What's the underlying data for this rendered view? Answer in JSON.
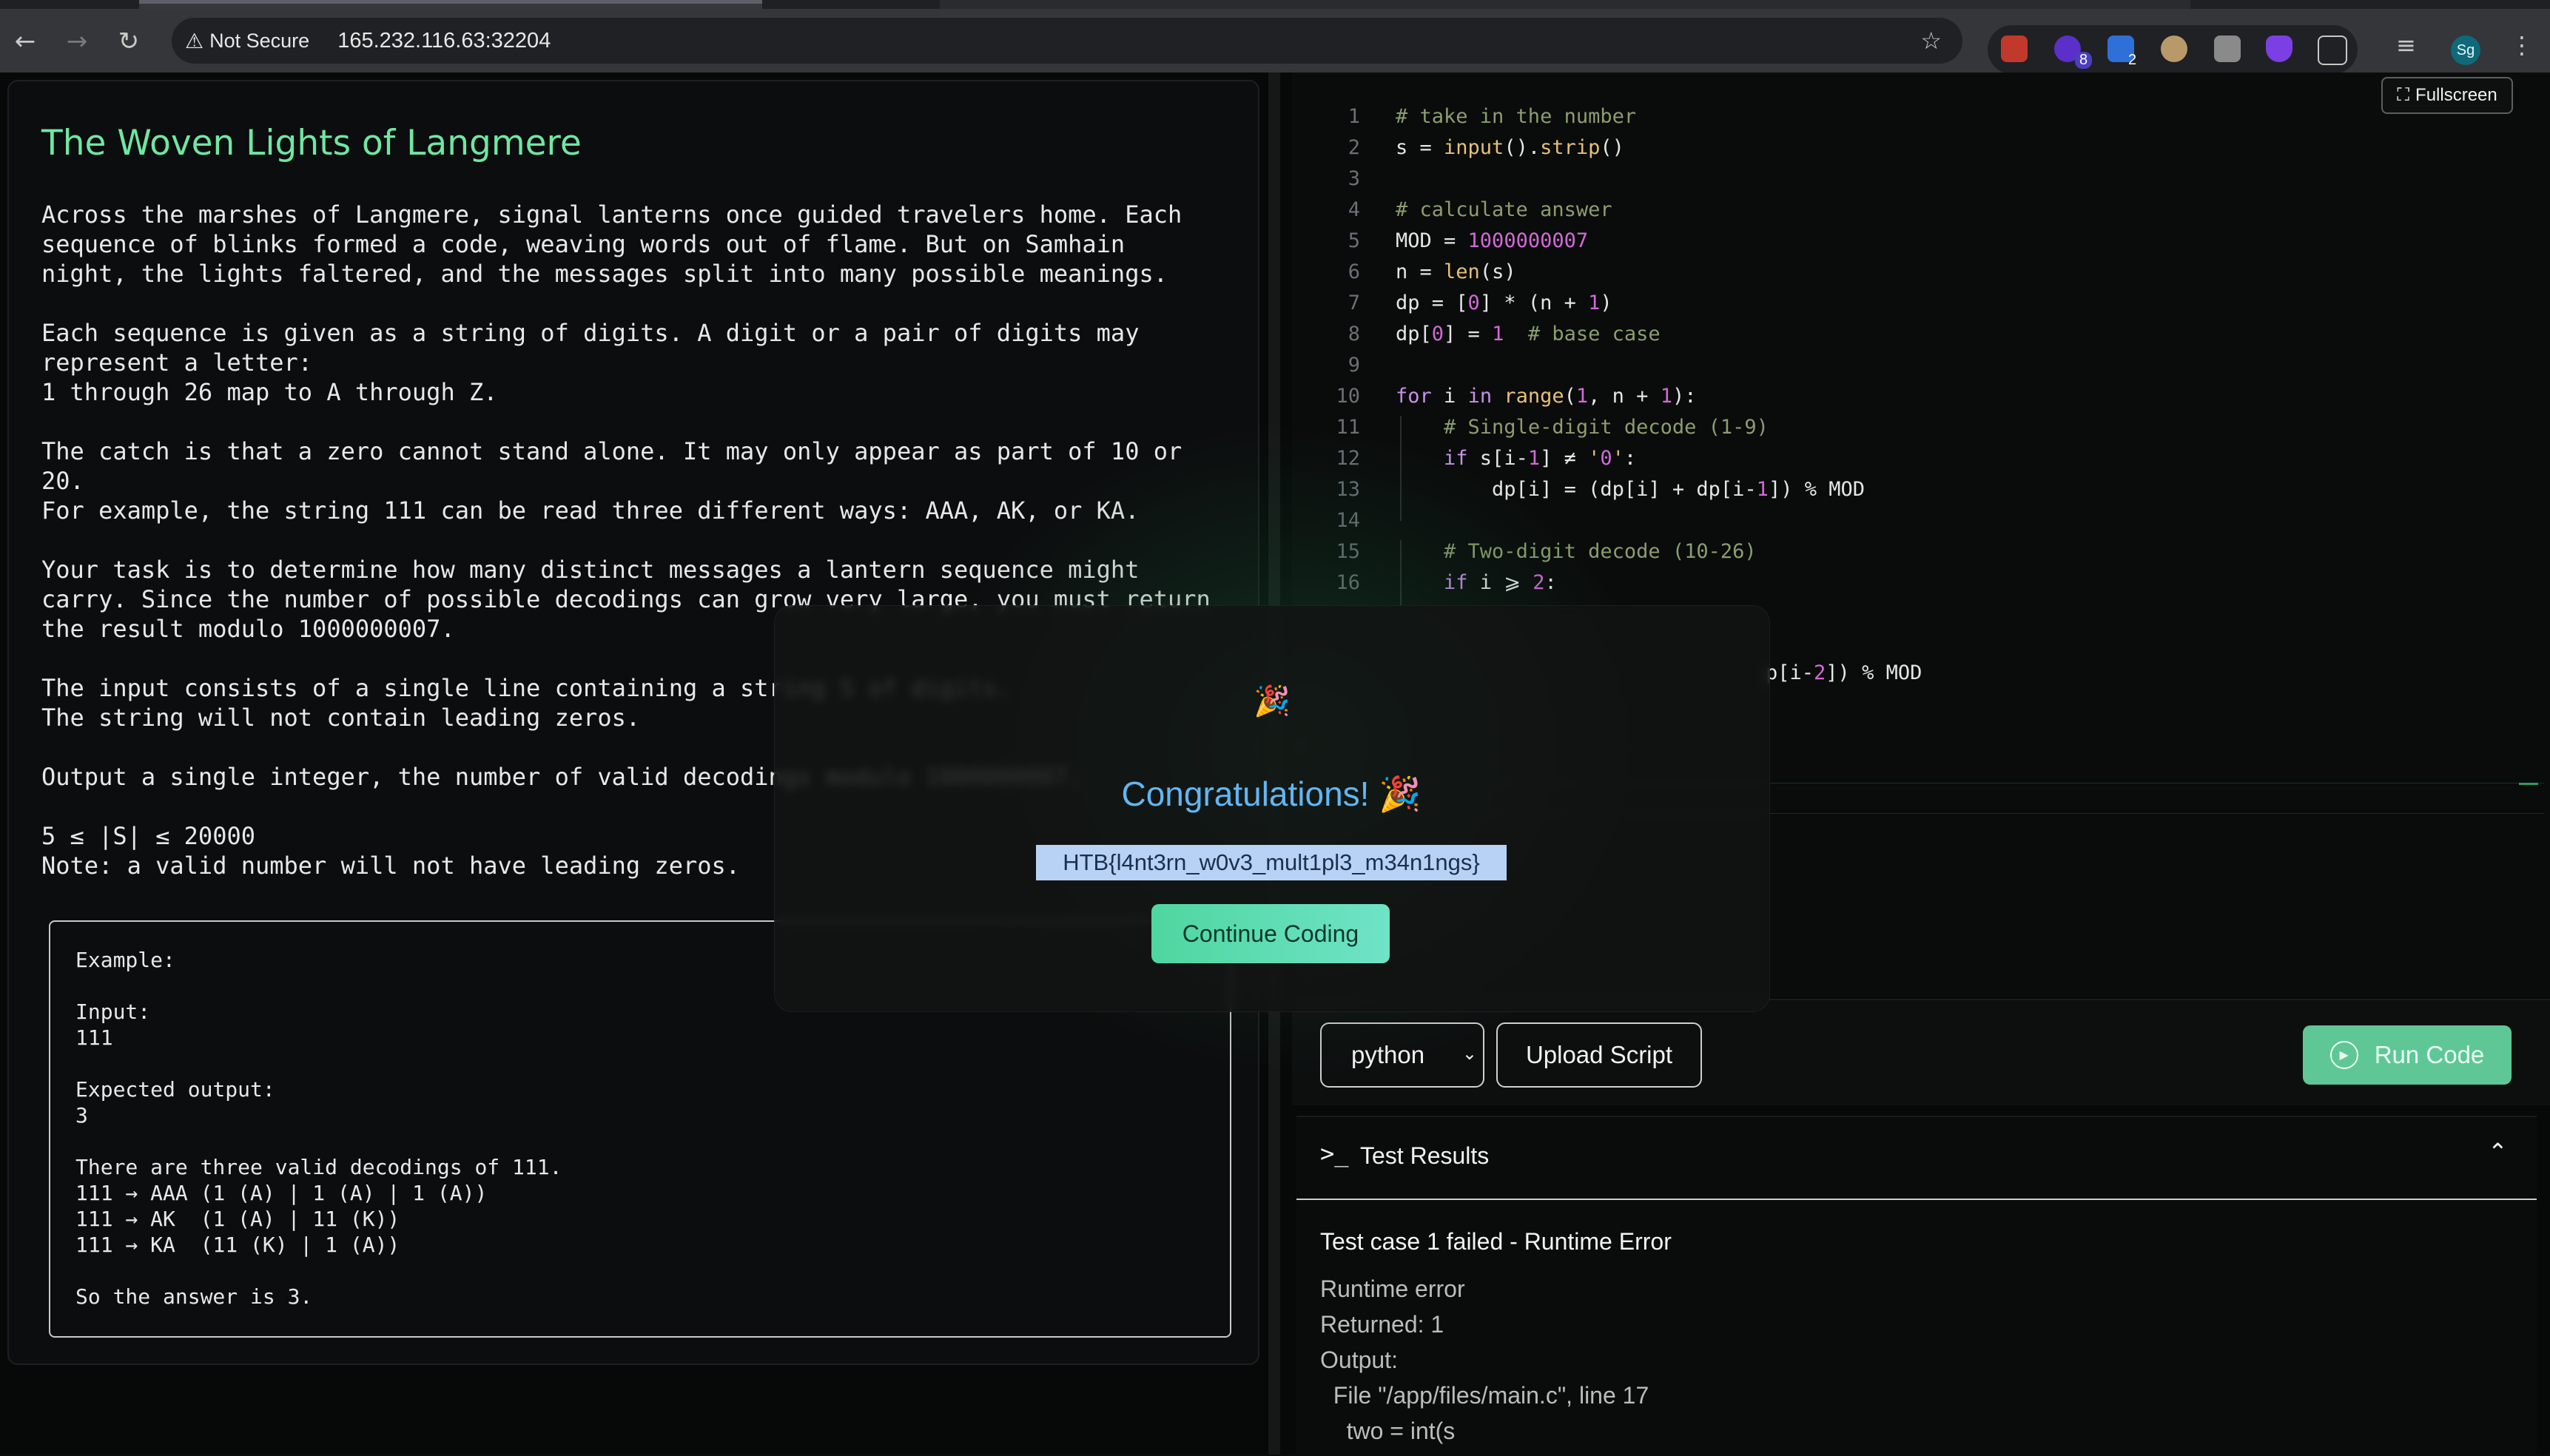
{
  "browser": {
    "security_label": "Not Secure",
    "url": "165.232.116.63:32204",
    "extension_badges": [
      "8",
      "2"
    ],
    "profile_initials": "Sg"
  },
  "problem": {
    "title": "The Woven Lights of Langmere",
    "description": [
      "Across the marshes of Langmere, signal lanterns once guided travelers home. Each",
      "sequence of blinks formed a code, weaving words out of flame. But on Samhain",
      "night, the lights faltered, and the messages split into many possible meanings.",
      "",
      "Each sequence is given as a string of digits. A digit or a pair of digits may",
      "represent a letter:",
      "1 through 26 map to A through Z.",
      "",
      "The catch is that a zero cannot stand alone. It may only appear as part of 10 or",
      "20.",
      "For example, the string 111 can be read three different ways: AAA, AK, or KA.",
      "",
      "Your task is to determine how many distinct messages a lantern sequence might",
      "carry. Since the number of possible decodings can grow very large, you must return",
      "the result modulo 1000000007.",
      "",
      "The input consists of a single line containing a string S of digits.",
      "The string will not contain leading zeros.",
      "",
      "Output a single integer, the number of valid decodings modulo 1000000007.",
      "",
      "5 ≤ |S| ≤ 20000",
      "Note: a valid number will not have leading zeros."
    ],
    "example": [
      "Example:",
      "",
      "Input:",
      "111",
      "",
      "Expected output:",
      "3",
      "",
      "There are three valid decodings of 111.",
      "111 → AAA (1 (A) | 1 (A) | 1 (A))",
      "111 → AK  (1 (A) | 11 (K))",
      "111 → KA  (11 (K) | 1 (A))",
      "",
      "So the answer is 3."
    ]
  },
  "editor": {
    "fullscreen_label": "Fullscreen",
    "line_numbers": [
      "1",
      "2",
      "3",
      "4",
      "5",
      "6",
      "7",
      "8",
      "9",
      "10",
      "11",
      "12",
      "13",
      "14",
      "15",
      "16"
    ],
    "code": [
      "# take in the number",
      "s = input().strip()",
      "",
      "# calculate answer",
      "MOD = 1000000007",
      "n = len(s)",
      "dp = [0] * (n + 1)",
      "dp[0] = 1  # base case",
      "",
      "for i in range(1, n + 1):",
      "    # Single-digit decode (1-9)",
      "    if s[i-1] != '0':",
      "        dp[i] = (dp[i] + dp[i-1]) % MOD",
      "",
      "    # Two-digit decode (10-26)",
      "    if i >= 2:"
    ],
    "partial_code_fragment": "p[i-2]) % MOD"
  },
  "controls": {
    "language": "python",
    "upload_label": "Upload Script",
    "run_label": "Run Code",
    "accent_color": "#5fc796"
  },
  "results": {
    "title": "Test Results",
    "status": "Test case 1 failed - Runtime Error",
    "lines": [
      "Runtime error",
      "Returned: 1",
      "Output:",
      "  File \"/app/files/main.c\", line 17",
      "    two = int(s"
    ]
  },
  "modal": {
    "heading": "Congratulations! 🎉",
    "flag": "HTB{l4nt3rn_w0v3_mult1pl3_m34n1ngs}",
    "continue_label": "Continue Coding",
    "accent_color": "#62b6f2"
  }
}
